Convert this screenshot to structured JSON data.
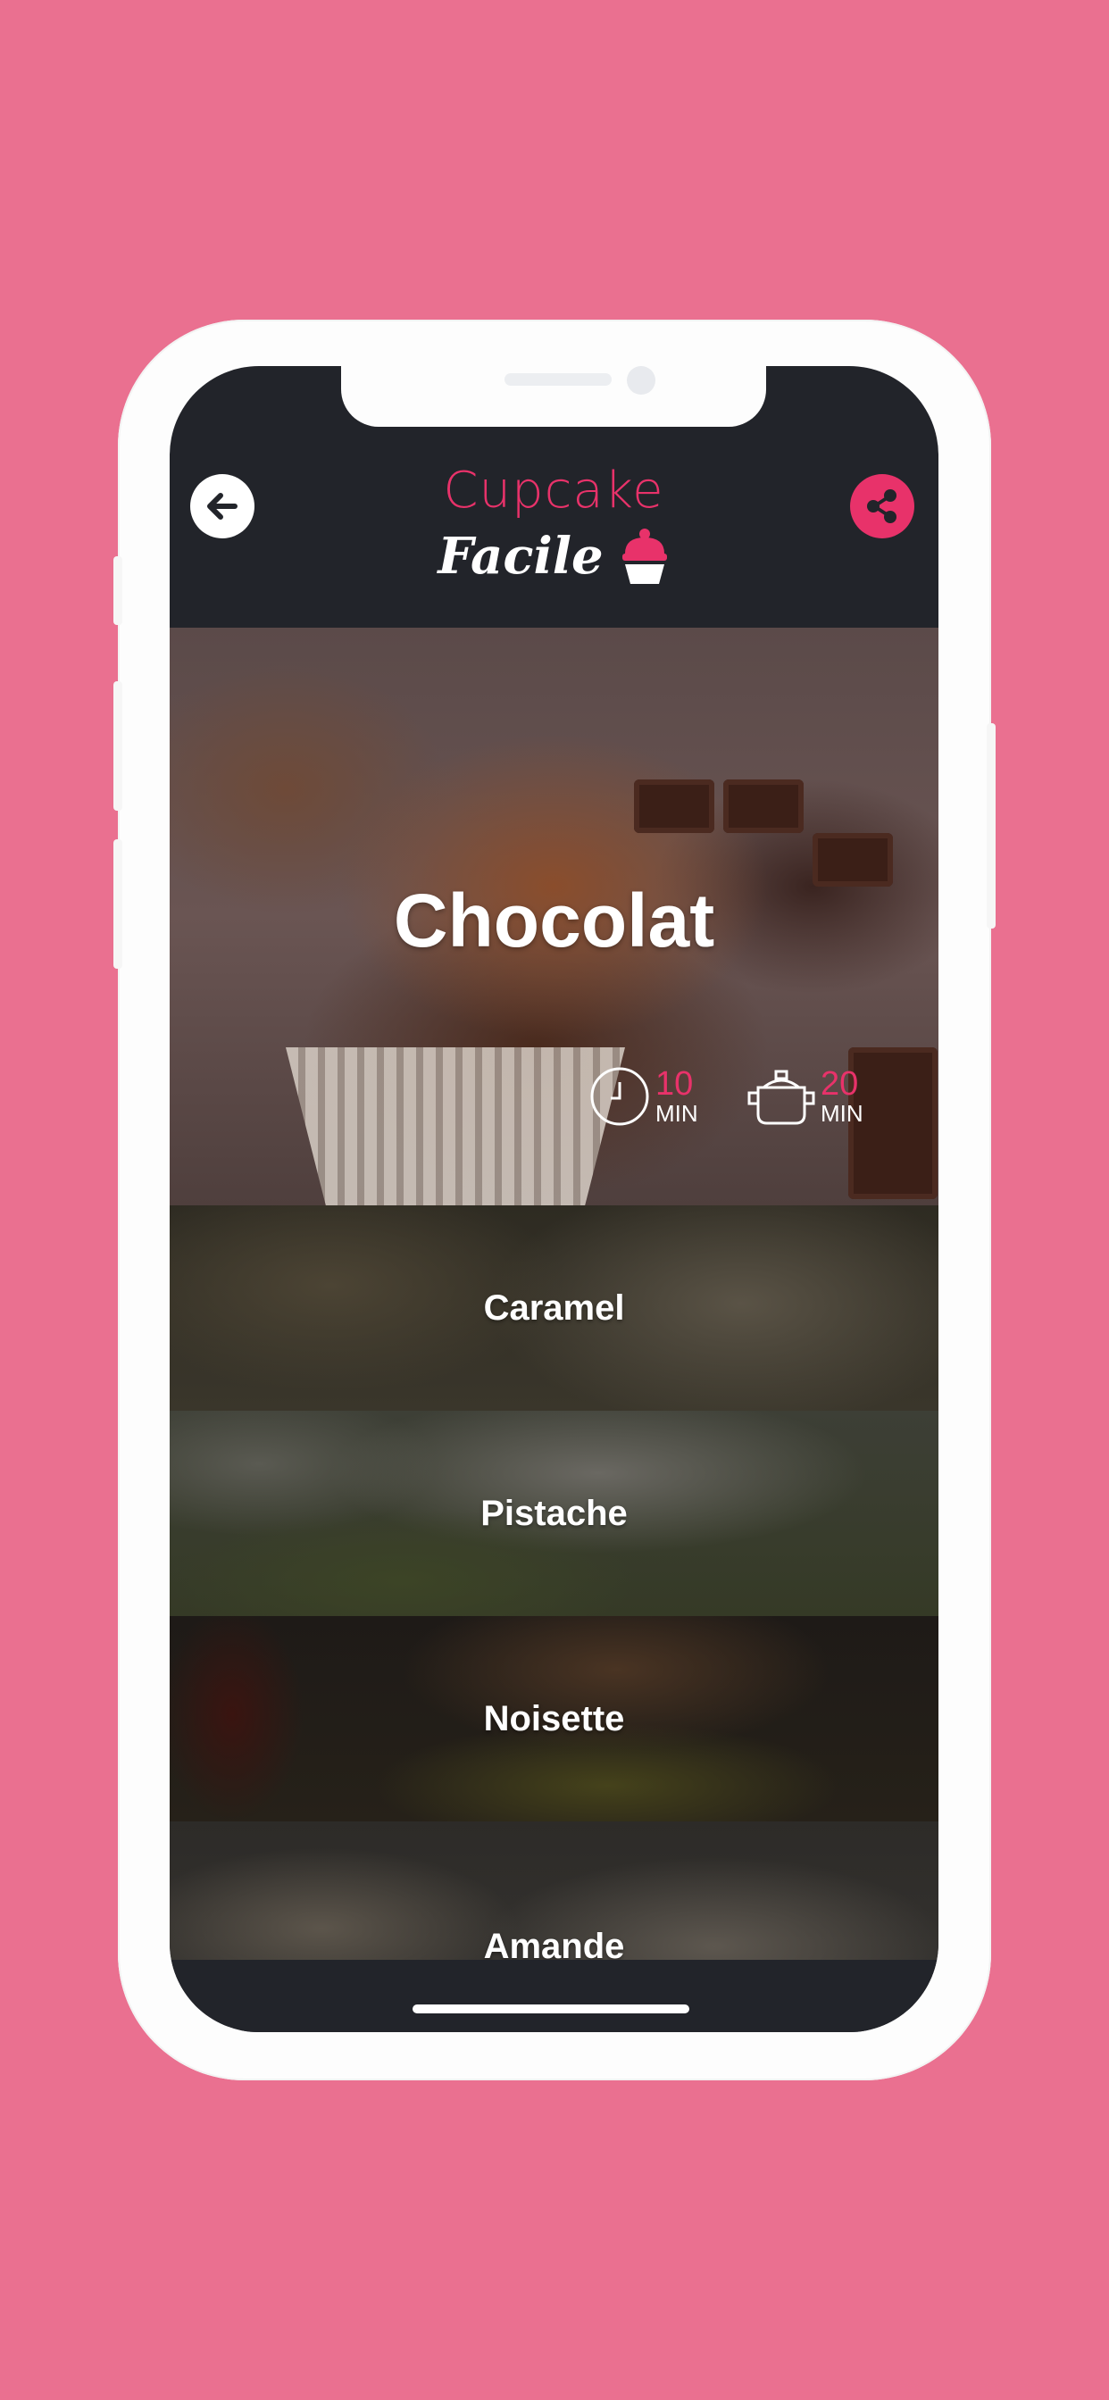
{
  "header": {
    "logo_line1": "Cupcake",
    "logo_line2": "Facile",
    "back_icon": "arrow-left-icon",
    "share_icon": "share-icon",
    "brand_pink": "#e8326a"
  },
  "hero": {
    "title": "Chocolat",
    "prep": {
      "value": "10",
      "unit": "MIN",
      "icon": "clock-icon"
    },
    "cook": {
      "value": "20",
      "unit": "MIN",
      "icon": "cooking-pot-icon"
    }
  },
  "recipes": [
    {
      "label": "Caramel"
    },
    {
      "label": "Pistache"
    },
    {
      "label": "Noisette"
    },
    {
      "label": "Amande"
    }
  ]
}
